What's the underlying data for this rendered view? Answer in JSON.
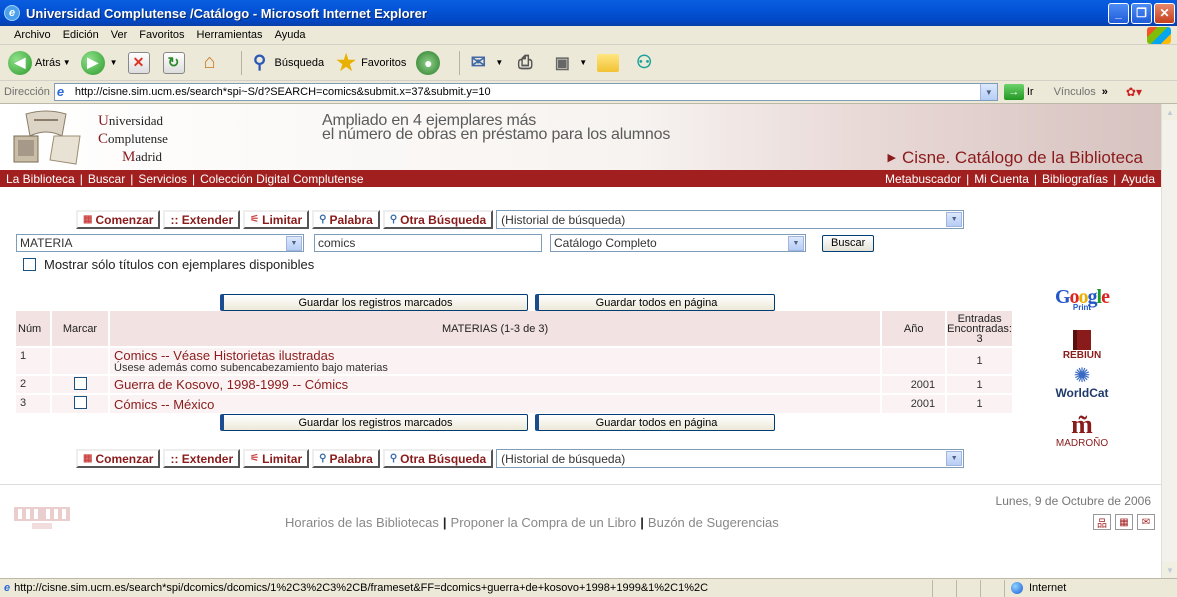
{
  "window": {
    "title": "Universidad Complutense /Catálogo - Microsoft Internet Explorer",
    "icon": "ie-icon"
  },
  "menu": [
    "Archivo",
    "Edición",
    "Ver",
    "Favoritos",
    "Herramientas",
    "Ayuda"
  ],
  "toolbar": {
    "back": "Atrás",
    "search": "Búsqueda",
    "favorites": "Favoritos"
  },
  "address": {
    "label": "Dirección",
    "url": "http://cisne.sim.ucm.es/search*spi~S/d?SEARCH=comics&submit.x=37&submit.y=10",
    "go": "Ir",
    "links": "Vínculos"
  },
  "header": {
    "univ_line1_cap": "U",
    "univ_line1": "niversidad",
    "univ_line2_cap": "C",
    "univ_line2": "omplutense",
    "univ_line3_cap": "M",
    "univ_line3": "adrid",
    "announce_line1": "Ampliado en 4 ejemplares más",
    "announce_line2": "el número de obras en préstamo  para los alumnos",
    "catalog_title": "Cisne. Catálogo de la Biblioteca"
  },
  "nav_left": [
    "La Biblioteca",
    "Buscar",
    "Servicios",
    "Colección Digital Complutense"
  ],
  "nav_right": [
    "Metabuscador",
    "Mi Cuenta",
    "Bibliografías",
    "Ayuda"
  ],
  "search_buttons": {
    "start": "Comenzar",
    "extend": ":: Extender",
    "limit": "Limitar",
    "word": "Palabra",
    "other": "Otra Búsqueda",
    "history": "(Historial de búsqueda)"
  },
  "search": {
    "field": "MATERIA",
    "term": "comics",
    "scope": "Catálogo Completo",
    "submit": "Buscar",
    "available_only": "Mostrar sólo títulos con ejemplares disponibles"
  },
  "save": {
    "marked": "Guardar los registros marcados",
    "all": "Guardar todos en página"
  },
  "table": {
    "headers": {
      "num": "Núm",
      "mark": "Marcar",
      "subjects": "MATERIAS (1-3 de 3)",
      "year": "Año",
      "entries_l1": "Entradas",
      "entries_l2": "Encontradas:",
      "entries_l3": "3"
    },
    "rows": [
      {
        "num": "1",
        "subject": "Comics -- Véase Historietas ilustradas",
        "note": "Úsese además como subencabezamiento bajo materias",
        "year": "",
        "count": "1"
      },
      {
        "num": "2",
        "subject": "Guerra de Kosovo, 1998-1999 -- Cómics",
        "note": "",
        "year": "2001",
        "count": "1"
      },
      {
        "num": "3",
        "subject": "Cómics -- México",
        "note": "",
        "year": "2001",
        "count": "1"
      }
    ]
  },
  "logos": {
    "google_g": "G",
    "google_o1": "o",
    "google_o2": "o",
    "google_g2": "g",
    "google_l": "l",
    "google_e": "e",
    "google_sub": "Print",
    "rebiun": "REBIUN",
    "worldcat": "WorldCat",
    "madrono": "MADROÑO"
  },
  "footer": {
    "date": "Lunes, 9 de Octubre de 2006",
    "links": [
      "Horarios de las Bibliotecas",
      "Proponer la Compra de un Libro",
      "Buzón de Sugerencias"
    ]
  },
  "status": {
    "url": "http://cisne.sim.ucm.es/search*spi/dcomics/dcomics/1%2C3%2C3%2CB/frameset&FF=dcomics+guerra+de+kosovo+1998+1999&1%2C1%2C",
    "zone": "Internet"
  },
  "colors": {
    "brand_red": "#a11f1f",
    "link": "#8a1b1b",
    "header_row": "#f2e2e2"
  }
}
